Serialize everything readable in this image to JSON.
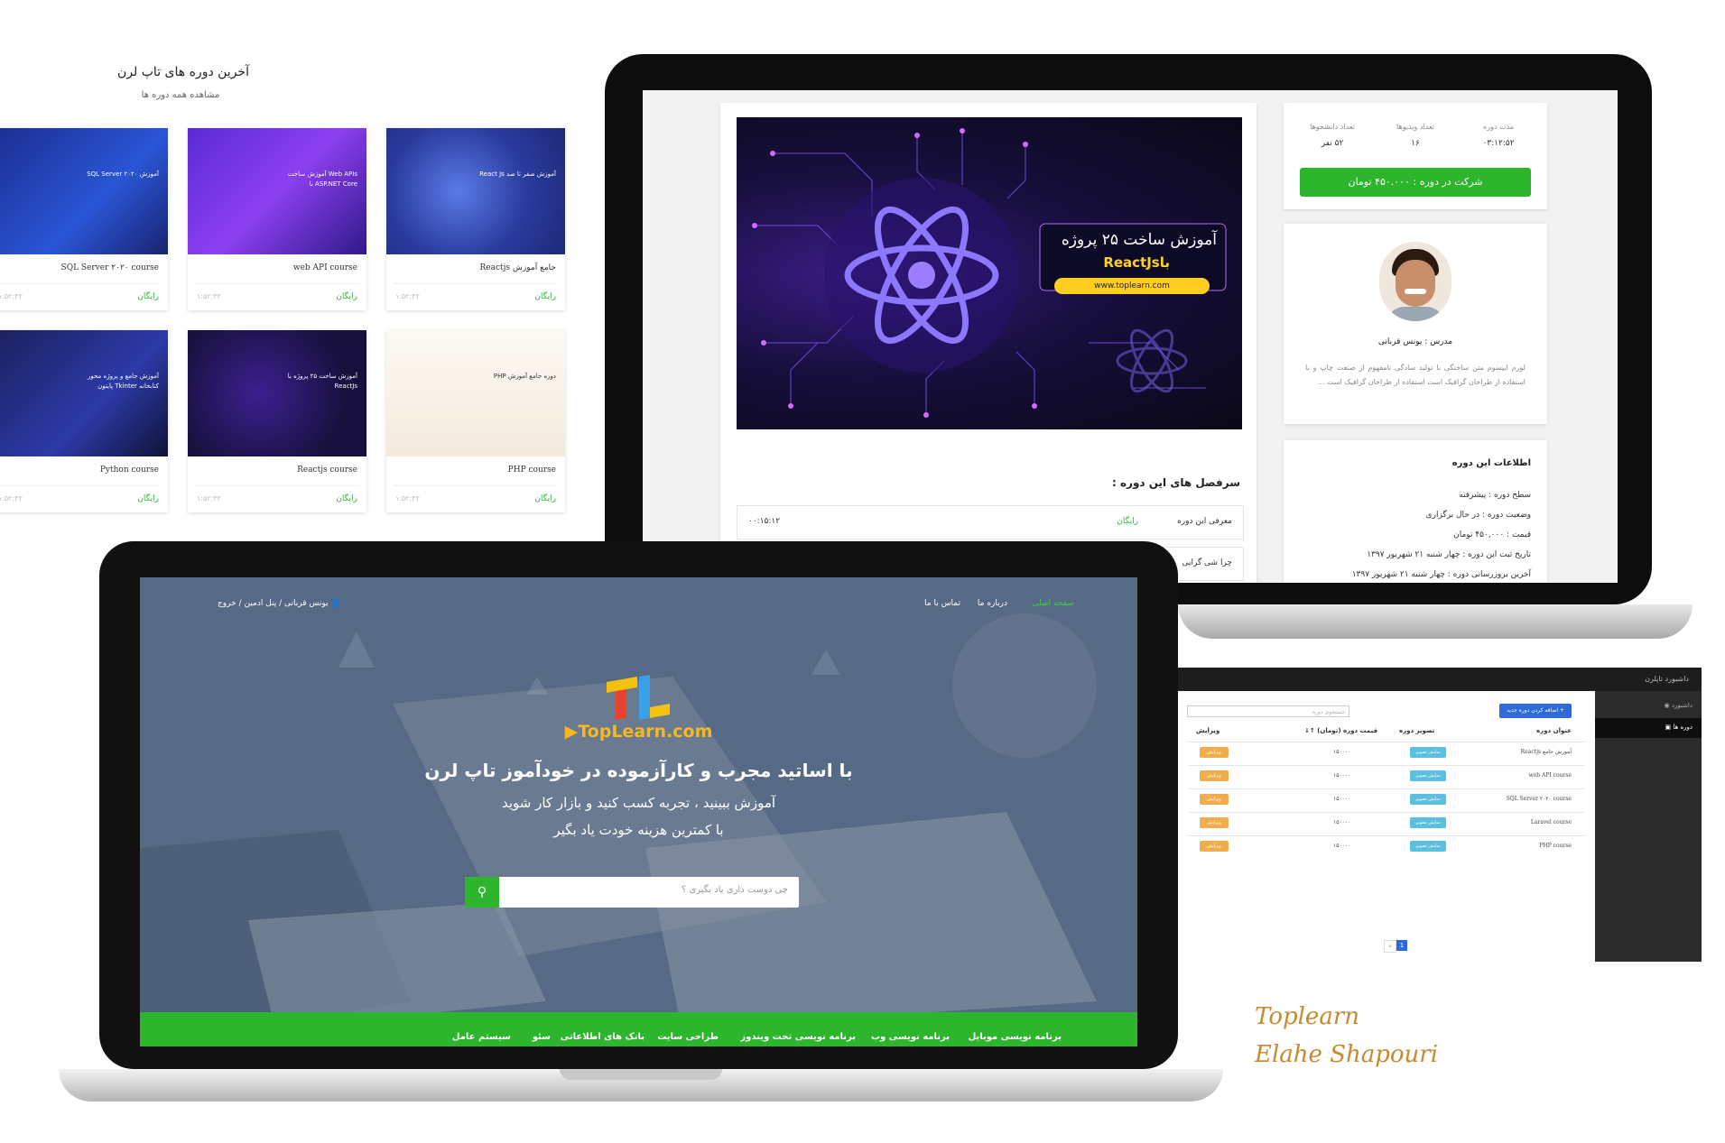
{
  "grid": {
    "title": "آخرین دوره های تاپ لرن",
    "subtitle": "مشاهده همه دوره ها",
    "cards": [
      {
        "title": "Reactjs جامع آموزش",
        "price": "رایگان",
        "time": "۱:۵۲:۳۲",
        "thumb_text": "آموزش صفر تا صد React Js"
      },
      {
        "title": "web API course",
        "price": "رایگان",
        "time": "۱:۵۲:۳۲",
        "thumb_text": "Web APIs آموزش ساخت ASP.NET Core با"
      },
      {
        "title": "SQL Server ۲۰۲۰ course",
        "price": "رایگان",
        "time": "۱:۵۲:۳۲",
        "thumb_text": "آموزش SQL Server ۲۰۲۰"
      },
      {
        "title": "PHP course",
        "price": "رایگان",
        "time": "۱:۵۲:۳۲",
        "thumb_text": "دوره جامع آموزش PHP"
      },
      {
        "title": "Reactjs course",
        "price": "رایگان",
        "time": "۱:۵۲:۳۲",
        "thumb_text": "آموزش ساخت ۲۵ پروژه با ReactJs"
      },
      {
        "title": "Python course",
        "price": "رایگان",
        "time": "۱:۵۲:۳۲",
        "thumb_text": "آموزش جامع و پروژه محور کتابخانه Tkinter پایتون"
      }
    ]
  },
  "monitor": {
    "banner": {
      "line1": "آموزش ساخت ۲۵ پروژه",
      "line2": "باReactJs",
      "url": "www.toplearn.com"
    },
    "stats": [
      {
        "label": "مدت دوره",
        "value": "۰۳:۱۲:۵۲"
      },
      {
        "label": "تعداد ویدیوها",
        "value": "۱۶"
      },
      {
        "label": "تعداد دانشجوها",
        "value": "۵۲ نفر"
      }
    ],
    "enroll_button": "شرکت در دوره : ۴۵۰.۰۰۰ تومان",
    "teacher_name": "مدرس : یونس قربانی",
    "teacher_bio": "لورم ایپسوم متن ساختگی با تولید سادگی نامفهوم از صنعت چاپ و با استفاده از طراحان گرافیک است استفاده از طراحان گرافیک است ...",
    "syllabus_title": "سرفصل های این دوره :",
    "syllabus": [
      {
        "title": "معرفی این دوره",
        "badge": "رایگان",
        "time": "۰۰:۱۵:۱۲"
      },
      {
        "title": "چرا شی گرایی",
        "badge": "",
        "time": ""
      }
    ],
    "info_title": "اطلاعات این دوره",
    "info_lines": [
      "سطح دوره : پیشرفته",
      "وضعیت دوره : در حال برگزاری",
      "قیمت : ۴۵۰,۰۰۰ تومان",
      "تاریخ ثبت این دوره : چهار شنبه ۲۱ شهریور ۱۳۹۷",
      "آخرین بروزرسانی دوره : چهار شنبه ۲۱ شهریور ۱۳۹۷"
    ]
  },
  "laptop": {
    "nav_links": [
      "صفحه اصلی",
      "درباره ما",
      "تماس با ما"
    ],
    "user_menu": "یونس قربانی / پنل ادمین / خروج",
    "logo_text": "TopLearn.com",
    "logo_mark": "TL",
    "headline": "با اساتید مجرب و کارآزموده در خودآموز تاپ لرن",
    "line2": "آموزش ببینید ، تجربه کسب کنید و بازار کار شوید",
    "line3": "با کمترین هزینه خودت یاد بگیر",
    "search_placeholder": "چی دوست داری یاد بگیری ؟",
    "menu": [
      "برنامه نویسی موبایل",
      "برنامه نویسی وب",
      "برنامه نویسی تحت ویندوز",
      "طراحی سایت",
      "بانک های اطلاعاتی",
      "سئو",
      "سیستم عامل"
    ],
    "green": "#2eb52e"
  },
  "admin": {
    "title": "داشبورد تاپلرن",
    "side_items": [
      "داشبورد",
      "دوره ها"
    ],
    "add_button": "+ اضافه کردن دوره جدید",
    "search_placeholder": "جستجوی دوره",
    "headers": [
      "عنوان دوره",
      "تصویر دوره",
      "قیمت دوره (تومان) ↑↓",
      "ویرایش"
    ],
    "rows": [
      {
        "title": "Reactjs آموزش جامع",
        "price": "۱۵۰۰۰۰",
        "img": "نمایش تصویر",
        "edit": "ویرایش"
      },
      {
        "title": "web API course",
        "price": "۱۵۰۰۰۰",
        "img": "نمایش تصویر",
        "edit": "ویرایش"
      },
      {
        "title": "SQL Server ۲۰۲۰ course",
        "price": "۱۵۰۰۰۰",
        "img": "نمایش تصویر",
        "edit": "ویرایش"
      },
      {
        "title": "Laravel course",
        "price": "۱۵۰۰۰۰",
        "img": "نمایش تصویر",
        "edit": "ویرایش"
      },
      {
        "title": "PHP course",
        "price": "۱۵۰۰۰۰",
        "img": "نمایش تصویر",
        "edit": "ویرایش"
      }
    ],
    "pages": [
      "«",
      "1"
    ]
  },
  "signature": {
    "line1": "Toplearn",
    "line2": "Elahe Shapouri"
  }
}
